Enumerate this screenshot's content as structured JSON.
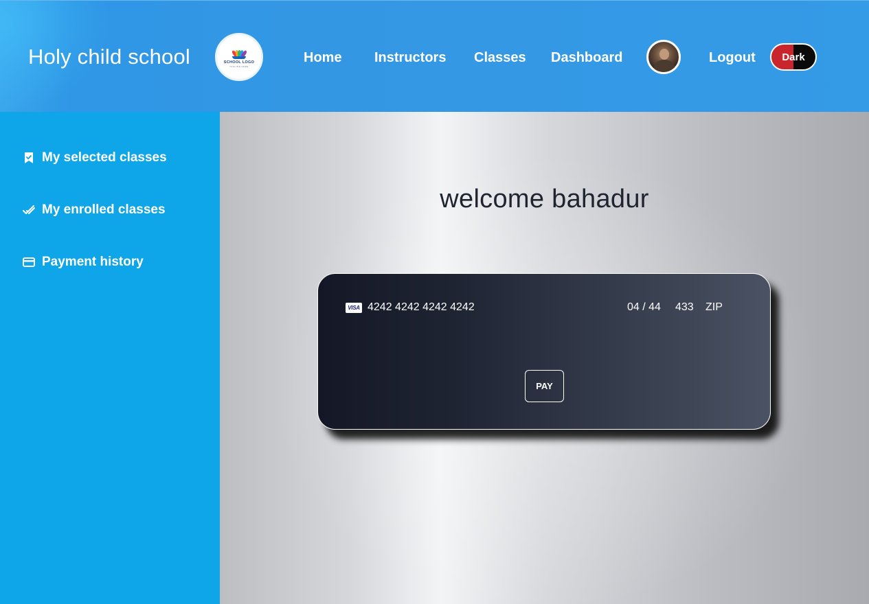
{
  "header": {
    "brand": "Holy child school",
    "logo": {
      "text": "SCHOOL LOGO",
      "subtext": "TAGLINE HERE"
    },
    "nav": [
      {
        "label": "Home"
      },
      {
        "label": "Instructors"
      },
      {
        "label": "Classes"
      },
      {
        "label": "Dashboard"
      }
    ],
    "logout_label": "Logout",
    "theme_toggle_label": "Dark"
  },
  "sidebar": {
    "items": [
      {
        "label": "My selected classes",
        "icon": "bookmark-check-icon"
      },
      {
        "label": "My enrolled classes",
        "icon": "double-check-icon"
      },
      {
        "label": "Payment history",
        "icon": "credit-card-icon"
      }
    ]
  },
  "main": {
    "welcome": "welcome bahadur",
    "payment": {
      "card_brand": "VISA",
      "card_number": "4242 4242 4242 4242",
      "expiry": "04 / 44",
      "cvc": "433",
      "zip_placeholder": "ZIP",
      "pay_label": "PAY"
    }
  },
  "colors": {
    "header_bg": "#3498e5",
    "sidebar_bg": "#0ea5e9",
    "card_bg_start": "#141826",
    "card_bg_end": "#4a5263",
    "toggle_red": "#c8252d"
  }
}
